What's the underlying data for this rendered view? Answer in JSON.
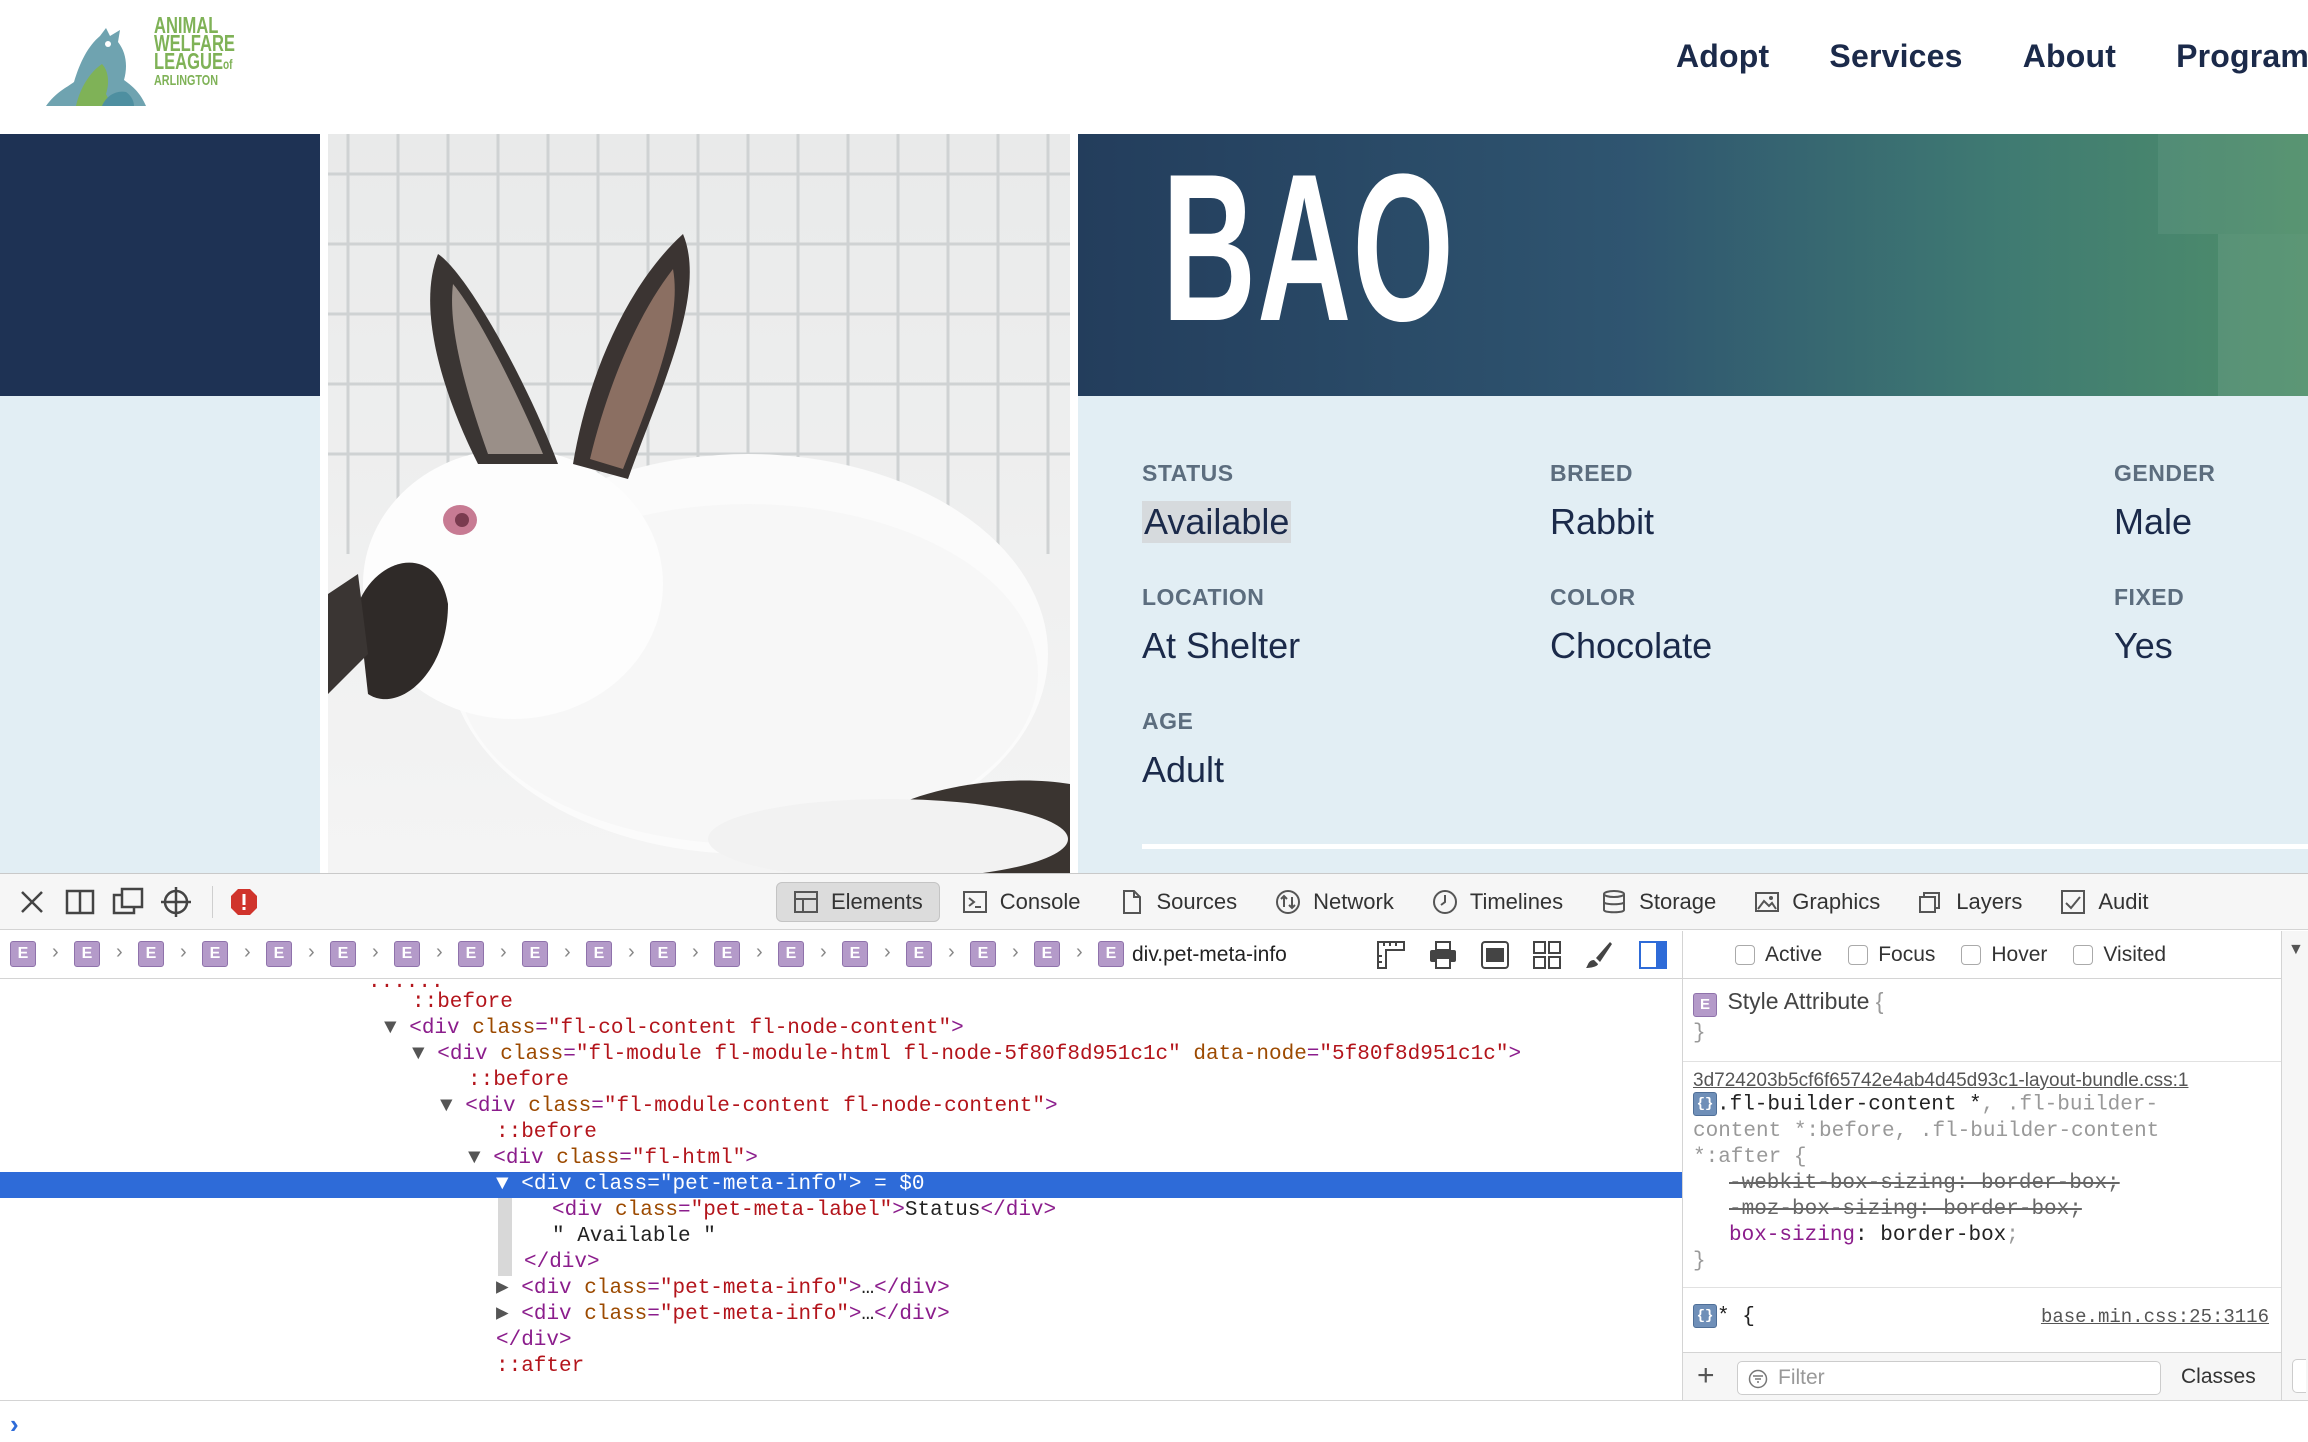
{
  "site": {
    "logo": {
      "line1": "ANIMAL",
      "line2": "WELFARE",
      "line3": "LEAGUE",
      "of": "of",
      "line4": "ARLINGTON"
    },
    "nav": [
      "Adopt",
      "Services",
      "About",
      "Programs"
    ],
    "pet": {
      "name": "BAO",
      "meta": [
        {
          "label": "STATUS",
          "value": "Available"
        },
        {
          "label": "BREED",
          "value": "Rabbit"
        },
        {
          "label": "GENDER",
          "value": "Male"
        },
        {
          "label": "LOCATION",
          "value": "At Shelter"
        },
        {
          "label": "COLOR",
          "value": "Chocolate"
        },
        {
          "label": "FIXED",
          "value": "Yes"
        },
        {
          "label": "AGE",
          "value": "Adult"
        }
      ]
    },
    "colors": {
      "navy": "#1e3254",
      "light_panel": "#e2eef4",
      "logo_green": "#7fb257"
    }
  },
  "devtools": {
    "tabs": [
      "Elements",
      "Console",
      "Sources",
      "Network",
      "Timelines",
      "Storage",
      "Graphics",
      "Layers",
      "Audit"
    ],
    "active_tab": "Elements",
    "breadcrumb_badge": "E",
    "breadcrumb_last": "div.pet-meta-info",
    "dom_lines": [
      {
        "text": "::before"
      },
      {
        "text": "div.fl-col-content"
      },
      {
        "text": "div.fl-module"
      },
      {
        "text": "::before"
      },
      {
        "text": "div.fl-module-content"
      },
      {
        "text": "::before"
      },
      {
        "text": "div.fl-html"
      },
      {
        "text": "div.pet-meta-info selected"
      },
      {
        "text": "div.pet-meta-label"
      },
      {
        "text": "Available text"
      },
      {
        "text": "close div"
      },
      {
        "text": "div.pet-meta-info collapsed"
      },
      {
        "text": "div.pet-meta-info collapsed"
      },
      {
        "text": "close div"
      },
      {
        "text": "::after"
      }
    ],
    "dom": {
      "trunc": ":.....",
      "before1": "::before",
      "col_open": "<div",
      "col_attr": "class",
      "col_val": "\"fl-col-content fl-node-content\"",
      "mod_attr2": "data-node",
      "mod_val": "\"fl-module fl-module-html fl-node-5f80f8d951c1c\"",
      "mod_val2": "\"5f80f8d951c1c\"",
      "before2": "::before",
      "modc_val": "\"fl-module-content fl-node-content\"",
      "before3": "::before",
      "html_val": "\"fl-html\"",
      "sel_val": "\"pet-meta-info\"",
      "sel_suffix": " = $0",
      "label_val": "\"pet-meta-label\"",
      "label_text": "Status",
      "close_div": "</div>",
      "text_node": "\" Available \"",
      "info_val": "\"pet-meta-info\"",
      "ellipsis": "…",
      "after": "::after"
    },
    "styles": {
      "pseudo": [
        "Active",
        "Focus",
        "Hover",
        "Visited"
      ],
      "style_attr": "Style Attribute",
      "rule1_src": "3d724203b5cf6f65742e4ab4d45d93c1-layout-bundle.css:1",
      "rule1_selector_line1": ".fl-builder-content *",
      "rule1_selector_dim1": ", .fl-builder-",
      "rule1_selector_line2": "content *:before, .fl-builder-content",
      "rule1_selector_line3": "*:after {",
      "rule1_prop1": "-webkit-box-sizing: border-box;",
      "rule1_prop2": "-moz-box-sizing: border-box;",
      "rule1_prop3_name": "box-sizing",
      "rule1_prop3_value": "border-box",
      "rule2_selector": "* {",
      "rule2_src": "base.min.css:25:3116",
      "filter_placeholder": "Filter",
      "classes_label": "Classes"
    }
  }
}
